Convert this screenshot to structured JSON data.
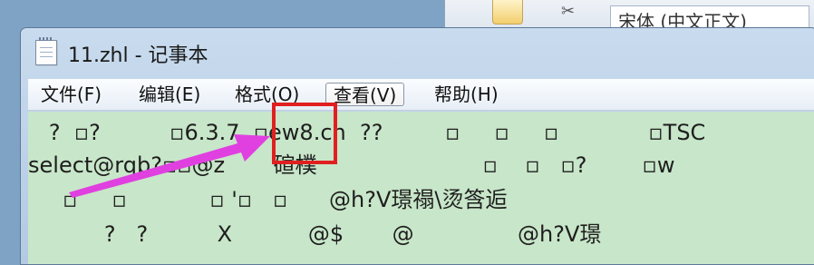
{
  "background_window": {
    "font_combo_value": "宋体 (中文正文)"
  },
  "window": {
    "title": "11.zhl - 记事本"
  },
  "menu": {
    "items": [
      {
        "label": "文件(F)"
      },
      {
        "label": "编辑(E)"
      },
      {
        "label": "格式(O)"
      },
      {
        "label": "查看(V)"
      },
      {
        "label": "帮助(H)"
      }
    ],
    "active_index": 3
  },
  "editor": {
    "background_color": "#c8e6c9",
    "lines": [
      "   ?  ▫?          ▫6.3.7  ▫ew8.cn  ??         ▫     ▫     ▫             ▫TSC",
      "select@rqb?▫▫@z       碹樸                        ▫    ▫   ▫?        ▫w",
      "     ▫     ▫            ▫ '▫   ▫      @h?V璟禢\\烫筨逅",
      "           ?   ?          X           @$       @               @h?V璟"
    ]
  },
  "annotation": {
    "highlight_color": "#e02020",
    "arrow_color": "#e040e0"
  }
}
